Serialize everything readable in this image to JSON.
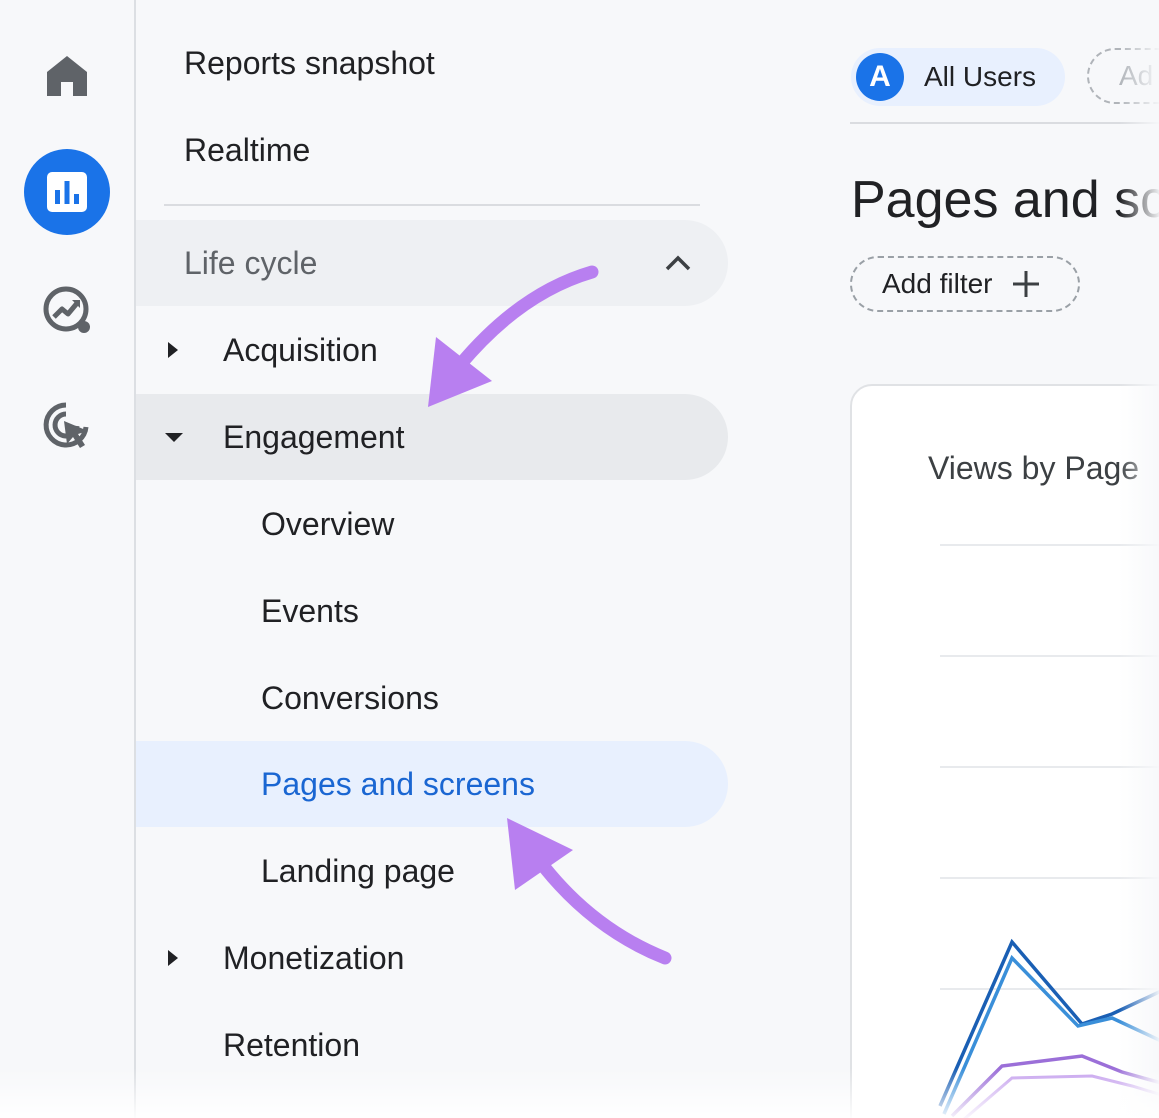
{
  "rail": {
    "items": [
      {
        "icon": "home-icon"
      },
      {
        "icon": "reports-icon",
        "active": true
      },
      {
        "icon": "explore-icon"
      },
      {
        "icon": "advertising-icon"
      }
    ]
  },
  "nav": {
    "reports_snapshot": "Reports snapshot",
    "realtime": "Realtime",
    "section": "Life cycle",
    "acquisition": "Acquisition",
    "engagement": "Engagement",
    "overview": "Overview",
    "events": "Events",
    "conversions": "Conversions",
    "pages_and_screens": "Pages and screens",
    "landing_page": "Landing page",
    "monetization": "Monetization",
    "retention": "Retention"
  },
  "main": {
    "segment_avatar": "A",
    "segment_label": "All Users",
    "segment_add": "Ad",
    "title": "Pages and sc",
    "filter_label": "Add filter",
    "card_title": "Views by Page"
  },
  "colors": {
    "accent": "#1a73e8",
    "active_text": "#1a66d2",
    "annotation_arrow": "#b87ff0"
  }
}
